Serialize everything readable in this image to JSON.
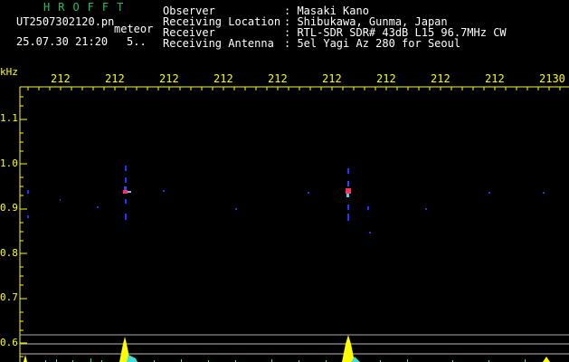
{
  "header": {
    "brand": "HROFFT",
    "filename": "UT2507302120.pn",
    "mode": "meteor",
    "datetime": "25.07.30 21:20",
    "count": "5.."
  },
  "info": {
    "labels": [
      "Observer",
      "Receiving Location",
      "Receiver",
      "Receiving Antenna"
    ],
    "values": [
      ": Masaki Kano",
      ": Shibukawa, Gunma, Japan",
      ": RTL-SDR SDR# 43dB L15 96.7MHz CW",
      ": 5el Yagi Az 280 for Seoul"
    ]
  },
  "y_axis": {
    "unit": "kHz",
    "ticks": [
      "1.1",
      "1.0",
      "0.9",
      "0.8",
      "0.7",
      "0.6"
    ]
  },
  "x_axis": {
    "ticks": [
      "212",
      "212",
      "212",
      "212",
      "212",
      "212",
      "212",
      "212",
      "212",
      "2130"
    ]
  },
  "colors": {
    "background": "#000000",
    "axis": "#ffff00",
    "brand": "#22c25a",
    "signal": "#2233ff",
    "peak": "#ff3355"
  }
}
